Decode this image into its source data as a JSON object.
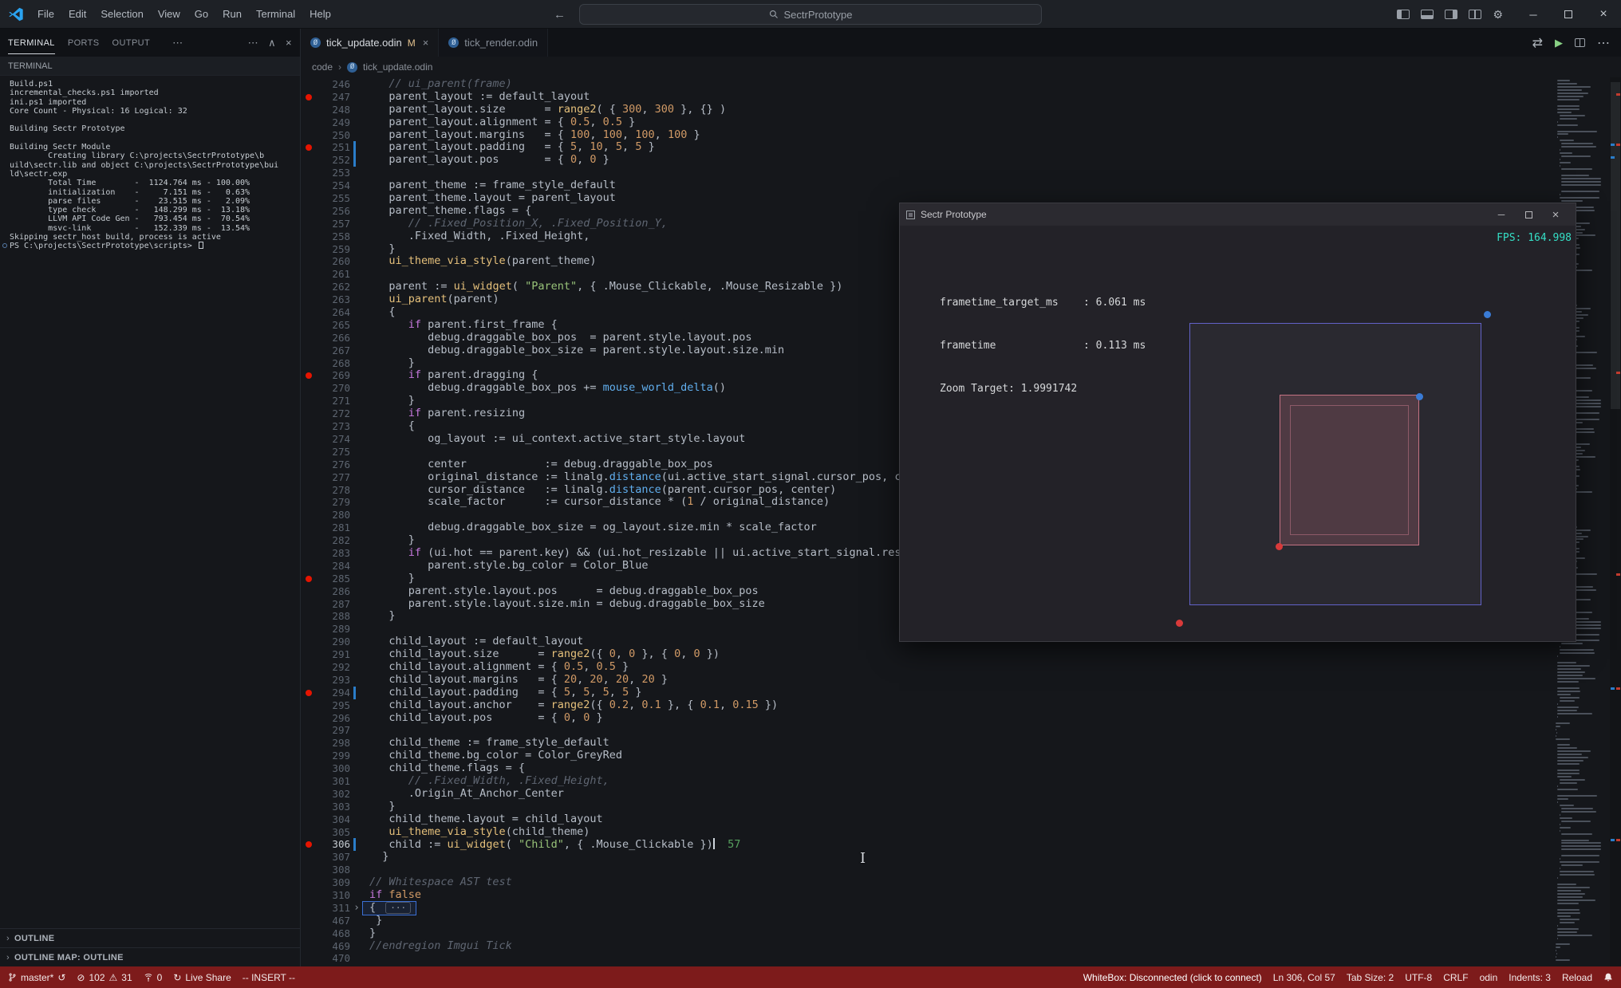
{
  "colors": {
    "statusbar_bg": "#7d1b1b",
    "fps_teal": "#35dfc6",
    "modified_badge": "#e2c08d",
    "run_green": "#89d185"
  },
  "icons": {
    "back": "←",
    "forward": "→",
    "more": "⋯",
    "chevron_right": "›",
    "chevron_up": "∧",
    "close": "×",
    "minimize": "─",
    "gear": "⚙",
    "play": "▶",
    "open_changes": "⇄",
    "error": "⊘",
    "warning": "⚠",
    "sync": "↺",
    "liveshare": "↻",
    "fold": "›",
    "odin": "Ø",
    "fold_dots": "···"
  },
  "titlebar": {
    "menus": [
      "File",
      "Edit",
      "Selection",
      "View",
      "Go",
      "Run",
      "Terminal",
      "Help"
    ],
    "search_value": "SectrPrototype"
  },
  "panel": {
    "tabs": [
      {
        "label": "TERMINAL",
        "active": true
      },
      {
        "label": "PORTS",
        "active": false
      },
      {
        "label": "OUTPUT",
        "active": false
      }
    ],
    "section_title": "TERMINAL",
    "terminal_lines": [
      "Build.ps1",
      "incremental_checks.ps1 imported",
      "ini.ps1 imported",
      "Core Count - Physical: 16 Logical: 32",
      "",
      "Building Sectr Prototype",
      "",
      "Building Sectr Module",
      "        Creating library C:\\projects\\SectrPrototype\\b",
      "uild\\sectr.lib and object C:\\projects\\SectrPrototype\\bui",
      "ld\\sectr.exp",
      "        Total Time        -  1124.764 ms - 100.00%",
      "        initialization    -     7.151 ms -   0.63%",
      "        parse files       -    23.515 ms -   2.09%",
      "        type check        -   148.299 ms -  13.18%",
      "        LLVM API Code Gen -   793.454 ms -  70.54%",
      "        msvc-link         -   152.339 ms -  13.54%",
      "Skipping sectr_host build, process is active",
      "PS C:\\projects\\SectrPrototype\\scripts> "
    ],
    "outline": "OUTLINE",
    "outline_map": "OUTLINE MAP: OUTLINE"
  },
  "editor": {
    "tabs": [
      {
        "label": "tick_update.odin",
        "badge": "M",
        "active": true
      },
      {
        "label": "tick_render.odin",
        "badge": "",
        "active": false
      }
    ],
    "breadcrumb": [
      "code",
      "tick_update.odin"
    ],
    "cursor_line": 306,
    "breakpoints": [
      247,
      251,
      269,
      285,
      294,
      306
    ],
    "modified_lines": [
      251,
      252,
      294,
      306
    ],
    "code": [
      {
        "n": 246,
        "s": [
          [
            "   ",
            "d"
          ],
          [
            "// ui_parent(frame)",
            "c"
          ]
        ]
      },
      {
        "n": 247,
        "s": [
          [
            "   parent_layout := default_layout",
            "d"
          ]
        ]
      },
      {
        "n": 248,
        "s": [
          [
            "   parent_layout.size      = ",
            "d"
          ],
          [
            "range2",
            "f"
          ],
          [
            "( { ",
            "d"
          ],
          [
            "300",
            "n"
          ],
          [
            ", ",
            "d"
          ],
          [
            "300",
            "n"
          ],
          [
            " }, {} )",
            "d"
          ]
        ]
      },
      {
        "n": 249,
        "s": [
          [
            "   parent_layout.alignment = { ",
            "d"
          ],
          [
            "0.5",
            "n"
          ],
          [
            ", ",
            "d"
          ],
          [
            "0.5",
            "n"
          ],
          [
            " }",
            "d"
          ]
        ]
      },
      {
        "n": 250,
        "s": [
          [
            "   parent_layout.margins   = { ",
            "d"
          ],
          [
            "100",
            "n"
          ],
          [
            ", ",
            "d"
          ],
          [
            "100",
            "n"
          ],
          [
            ", ",
            "d"
          ],
          [
            "100",
            "n"
          ],
          [
            ", ",
            "d"
          ],
          [
            "100",
            "n"
          ],
          [
            " }",
            "d"
          ]
        ]
      },
      {
        "n": 251,
        "s": [
          [
            "   parent_layout.padding   = { ",
            "d"
          ],
          [
            "5",
            "n"
          ],
          [
            ", ",
            "d"
          ],
          [
            "10",
            "n"
          ],
          [
            ", ",
            "d"
          ],
          [
            "5",
            "n"
          ],
          [
            ", ",
            "d"
          ],
          [
            "5",
            "n"
          ],
          [
            " }",
            "d"
          ]
        ]
      },
      {
        "n": 252,
        "s": [
          [
            "   parent_layout.pos       = { ",
            "d"
          ],
          [
            "0",
            "n"
          ],
          [
            ", ",
            "d"
          ],
          [
            "0",
            "n"
          ],
          [
            " }",
            "d"
          ]
        ]
      },
      {
        "n": 253,
        "s": []
      },
      {
        "n": 254,
        "s": [
          [
            "   parent_theme := frame_style_default",
            "d"
          ]
        ]
      },
      {
        "n": 255,
        "s": [
          [
            "   parent_theme.layout = parent_layout",
            "d"
          ]
        ]
      },
      {
        "n": 256,
        "s": [
          [
            "   parent_theme.flags = {",
            "d"
          ]
        ]
      },
      {
        "n": 257,
        "s": [
          [
            "      ",
            "d"
          ],
          [
            "// .Fixed_Position_X, .Fixed_Position_Y,",
            "c"
          ]
        ]
      },
      {
        "n": 258,
        "s": [
          [
            "      .Fixed_Width, .Fixed_Height,",
            "d"
          ]
        ]
      },
      {
        "n": 259,
        "s": [
          [
            "   }",
            "d"
          ]
        ]
      },
      {
        "n": 260,
        "s": [
          [
            "   ",
            "d"
          ],
          [
            "ui_theme_via_style",
            "f"
          ],
          [
            "(parent_theme)",
            "d"
          ]
        ]
      },
      {
        "n": 261,
        "s": []
      },
      {
        "n": 262,
        "s": [
          [
            "   parent := ",
            "d"
          ],
          [
            "ui_widget",
            "f"
          ],
          [
            "( ",
            "d"
          ],
          [
            "\"Parent\"",
            "s"
          ],
          [
            ", { .Mouse_Clickable, .Mouse_Resizable })",
            "d"
          ]
        ]
      },
      {
        "n": 263,
        "s": [
          [
            "   ",
            "d"
          ],
          [
            "ui_parent",
            "f"
          ],
          [
            "(parent)",
            "d"
          ]
        ]
      },
      {
        "n": 264,
        "s": [
          [
            "   {",
            "d"
          ]
        ]
      },
      {
        "n": 265,
        "s": [
          [
            "      ",
            "d"
          ],
          [
            "if",
            "k"
          ],
          [
            " parent.first_frame {",
            "d"
          ]
        ]
      },
      {
        "n": 266,
        "s": [
          [
            "         debug.draggable_box_pos  = parent.style.layout.pos",
            "d"
          ]
        ]
      },
      {
        "n": 267,
        "s": [
          [
            "         debug.draggable_box_size = parent.style.layout.size.min",
            "d"
          ]
        ]
      },
      {
        "n": 268,
        "s": [
          [
            "      }",
            "d"
          ]
        ]
      },
      {
        "n": 269,
        "s": [
          [
            "      ",
            "d"
          ],
          [
            "if",
            "k"
          ],
          [
            " parent.dragging {",
            "d"
          ]
        ]
      },
      {
        "n": 270,
        "s": [
          [
            "         debug.draggable_box_pos += ",
            "d"
          ],
          [
            "mouse_world_delta",
            "b"
          ],
          [
            "()",
            "d"
          ]
        ]
      },
      {
        "n": 271,
        "s": [
          [
            "      }",
            "d"
          ]
        ]
      },
      {
        "n": 272,
        "s": [
          [
            "      ",
            "d"
          ],
          [
            "if",
            "k"
          ],
          [
            " parent.resizing",
            "d"
          ]
        ]
      },
      {
        "n": 273,
        "s": [
          [
            "      {",
            "d"
          ]
        ]
      },
      {
        "n": 274,
        "s": [
          [
            "         og_layout := ui_context.active_start_style.layout",
            "d"
          ]
        ]
      },
      {
        "n": 275,
        "s": []
      },
      {
        "n": 276,
        "s": [
          [
            "         center            := debug.draggable_box_pos",
            "d"
          ]
        ]
      },
      {
        "n": 277,
        "s": [
          [
            "         original_distance := linalg.",
            "d"
          ],
          [
            "distance",
            "b"
          ],
          [
            "(ui.active_start_signal.cursor_pos, center)",
            "d"
          ]
        ]
      },
      {
        "n": 278,
        "s": [
          [
            "         cursor_distance   := linalg.",
            "d"
          ],
          [
            "distance",
            "b"
          ],
          [
            "(parent.cursor_pos, center)",
            "d"
          ]
        ]
      },
      {
        "n": 279,
        "s": [
          [
            "         scale_factor      := cursor_distance * (",
            "d"
          ],
          [
            "1",
            "n"
          ],
          [
            " / original_distance)",
            "d"
          ]
        ]
      },
      {
        "n": 280,
        "s": []
      },
      {
        "n": 281,
        "s": [
          [
            "         debug.draggable_box_size = og_layout.size.min * scale_factor",
            "d"
          ]
        ]
      },
      {
        "n": 282,
        "s": [
          [
            "      }",
            "d"
          ]
        ]
      },
      {
        "n": 283,
        "s": [
          [
            "      ",
            "d"
          ],
          [
            "if",
            "k"
          ],
          [
            " (ui.hot == parent.key) && (ui.hot_resizable || ui.active_start_signal.resizing) {",
            "d"
          ]
        ]
      },
      {
        "n": 284,
        "s": [
          [
            "         parent.style.bg_color = Color_Blue",
            "d"
          ]
        ]
      },
      {
        "n": 285,
        "s": [
          [
            "      }",
            "d"
          ]
        ]
      },
      {
        "n": 286,
        "s": [
          [
            "      parent.style.layout.pos      = debug.draggable_box_pos",
            "d"
          ]
        ]
      },
      {
        "n": 287,
        "s": [
          [
            "      parent.style.layout.size.min = debug.draggable_box_size",
            "d"
          ]
        ]
      },
      {
        "n": 288,
        "s": [
          [
            "   }",
            "d"
          ]
        ]
      },
      {
        "n": 289,
        "s": []
      },
      {
        "n": 290,
        "s": [
          [
            "   child_layout := default_layout",
            "d"
          ]
        ]
      },
      {
        "n": 291,
        "s": [
          [
            "   child_layout.size      = ",
            "d"
          ],
          [
            "range2",
            "f"
          ],
          [
            "({ ",
            "d"
          ],
          [
            "0",
            "n"
          ],
          [
            ", ",
            "d"
          ],
          [
            "0",
            "n"
          ],
          [
            " }, { ",
            "d"
          ],
          [
            "0",
            "n"
          ],
          [
            ", ",
            "d"
          ],
          [
            "0",
            "n"
          ],
          [
            " })",
            "d"
          ]
        ]
      },
      {
        "n": 292,
        "s": [
          [
            "   child_layout.alignment = { ",
            "d"
          ],
          [
            "0.5",
            "n"
          ],
          [
            ", ",
            "d"
          ],
          [
            "0.5",
            "n"
          ],
          [
            " }",
            "d"
          ]
        ]
      },
      {
        "n": 293,
        "s": [
          [
            "   child_layout.margins   = { ",
            "d"
          ],
          [
            "20",
            "n"
          ],
          [
            ", ",
            "d"
          ],
          [
            "20",
            "n"
          ],
          [
            ", ",
            "d"
          ],
          [
            "20",
            "n"
          ],
          [
            ", ",
            "d"
          ],
          [
            "20",
            "n"
          ],
          [
            " }",
            "d"
          ]
        ]
      },
      {
        "n": 294,
        "s": [
          [
            "   child_layout.padding   = { ",
            "d"
          ],
          [
            "5",
            "n"
          ],
          [
            ", ",
            "d"
          ],
          [
            "5",
            "n"
          ],
          [
            ", ",
            "d"
          ],
          [
            "5",
            "n"
          ],
          [
            ", ",
            "d"
          ],
          [
            "5",
            "n"
          ],
          [
            " }",
            "d"
          ]
        ]
      },
      {
        "n": 295,
        "s": [
          [
            "   child_layout.anchor    = ",
            "d"
          ],
          [
            "range2",
            "f"
          ],
          [
            "({ ",
            "d"
          ],
          [
            "0.2",
            "n"
          ],
          [
            ", ",
            "d"
          ],
          [
            "0.1",
            "n"
          ],
          [
            " }, { ",
            "d"
          ],
          [
            "0.1",
            "n"
          ],
          [
            ", ",
            "d"
          ],
          [
            "0.15",
            "n"
          ],
          [
            " })",
            "d"
          ]
        ]
      },
      {
        "n": 296,
        "s": [
          [
            "   child_layout.pos       = { ",
            "d"
          ],
          [
            "0",
            "n"
          ],
          [
            ", ",
            "d"
          ],
          [
            "0",
            "n"
          ],
          [
            " }",
            "d"
          ]
        ]
      },
      {
        "n": 297,
        "s": []
      },
      {
        "n": 298,
        "s": [
          [
            "   child_theme := frame_style_default",
            "d"
          ]
        ]
      },
      {
        "n": 299,
        "s": [
          [
            "   child_theme.bg_color = Color_GreyRed",
            "d"
          ]
        ]
      },
      {
        "n": 300,
        "s": [
          [
            "   child_theme.flags = {",
            "d"
          ]
        ]
      },
      {
        "n": 301,
        "s": [
          [
            "      ",
            "d"
          ],
          [
            "// .Fixed_Width, .Fixed_Height,",
            "c"
          ]
        ]
      },
      {
        "n": 302,
        "s": [
          [
            "      .Origin_At_Anchor_Center",
            "d"
          ]
        ]
      },
      {
        "n": 303,
        "s": [
          [
            "   }",
            "d"
          ]
        ]
      },
      {
        "n": 304,
        "s": [
          [
            "   child_theme.layout = child_layout",
            "d"
          ]
        ]
      },
      {
        "n": 305,
        "s": [
          [
            "   ",
            "d"
          ],
          [
            "ui_theme_via_style",
            "f"
          ],
          [
            "(child_theme)",
            "d"
          ]
        ]
      },
      {
        "n": 306,
        "s": [
          [
            "   child := ",
            "d"
          ],
          [
            "ui_widget",
            "f"
          ],
          [
            "( ",
            "d"
          ],
          [
            "\"Child\"",
            "s"
          ],
          [
            ", { .Mouse_Clickable })",
            "d"
          ],
          [
            "",
            "caret"
          ],
          [
            "  57",
            "g"
          ]
        ]
      },
      {
        "n": 307,
        "s": [
          [
            "  }",
            "d"
          ]
        ]
      },
      {
        "n": 308,
        "s": []
      },
      {
        "n": 309,
        "s": [
          [
            "// Whitespace AST test",
            "c"
          ]
        ]
      },
      {
        "n": 310,
        "s": [
          [
            "if",
            "k"
          ],
          [
            " ",
            "d"
          ],
          [
            "false",
            "n"
          ]
        ]
      },
      {
        "n": 311,
        "fold": true,
        "sel": true,
        "s": [
          [
            "{ ",
            "d"
          ]
        ]
      },
      {
        "n": 467,
        "s": [
          [
            " }",
            "d"
          ]
        ]
      },
      {
        "n": 468,
        "s": [
          [
            "}",
            "d"
          ]
        ]
      },
      {
        "n": 469,
        "s": [
          [
            "//endregion Imgui Tick",
            "c"
          ]
        ]
      },
      {
        "n": 470,
        "s": []
      }
    ]
  },
  "overlay": {
    "title": "Sectr Prototype",
    "fps": "FPS: 164.998",
    "stats": [
      "frametime_target_ms    : 6.061 ms",
      "frametime              : 0.113 ms",
      "Zoom Target: 1.9991742"
    ]
  },
  "statusbar": {
    "branch": "master*",
    "errors": "102",
    "warnings": "31",
    "ports": "0",
    "live_share": "Live Share",
    "mode": "-- INSERT --",
    "whitebox": "WhiteBox: Disconnected (click to connect)",
    "line_col": "Ln 306, Col 57",
    "tab_size": "Tab Size: 2",
    "encoding": "UTF-8",
    "eol": "CRLF",
    "language": "odin",
    "indents": "Indents: 3",
    "reload": "Reload"
  }
}
